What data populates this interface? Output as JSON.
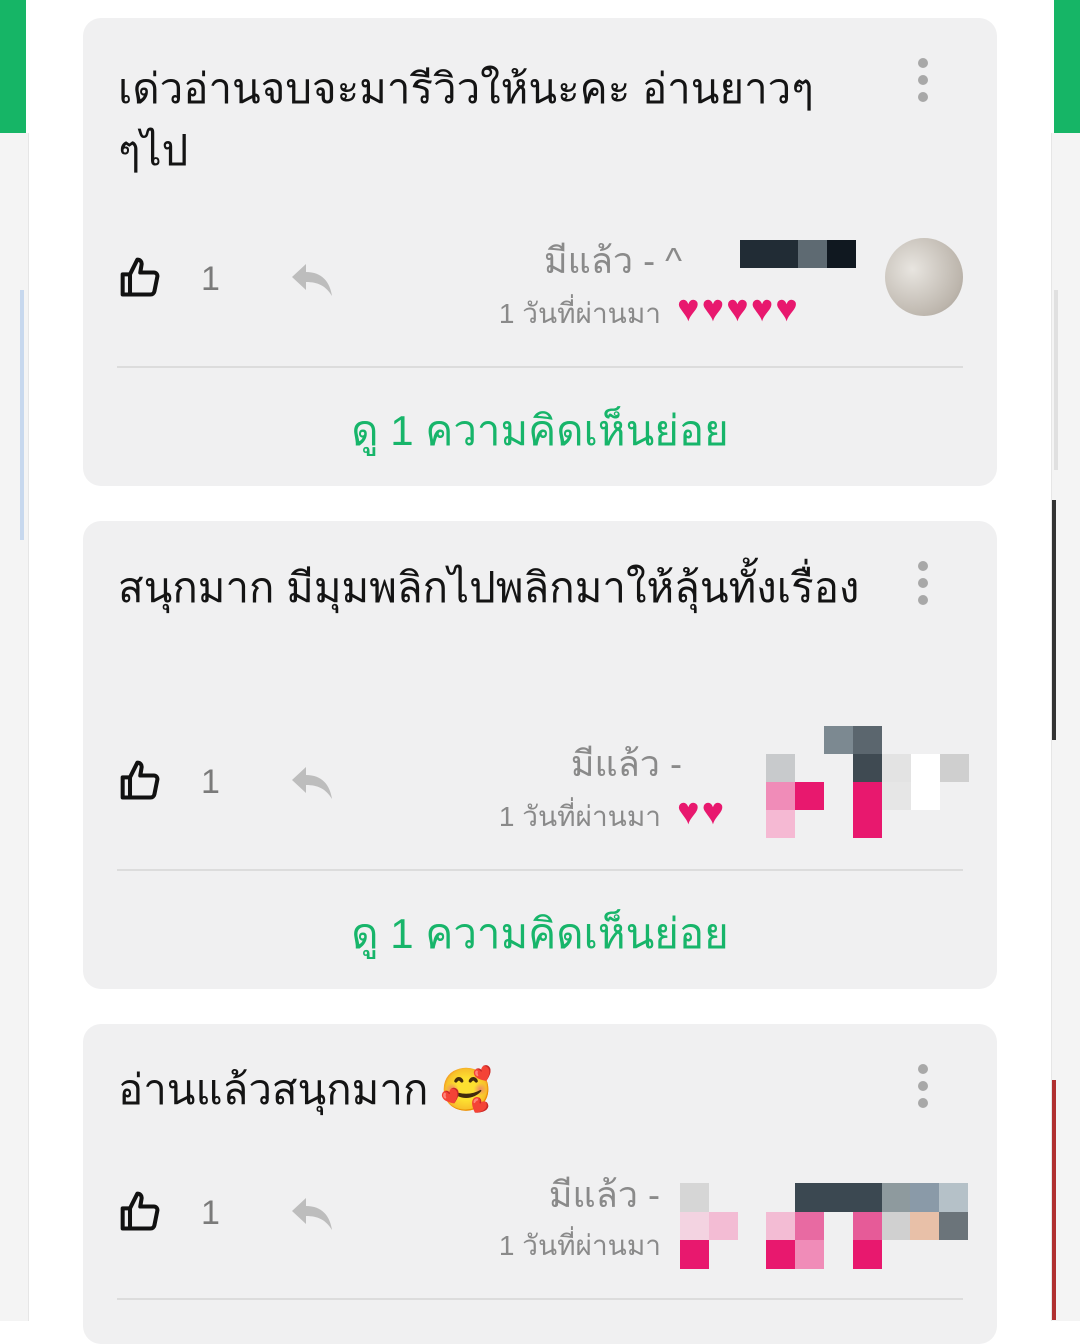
{
  "comments": [
    {
      "text": "เด่วอ่านจบจะมารีวิวให้นะคะ อ่านยาวๆ ๆไป",
      "likes": "1",
      "author": "มีแล้ว - ^",
      "time": "1 วันที่ผ่านมา",
      "hearts": "💗💗💗💗💗",
      "replies_link": "ดู 1 ความคิดเห็นย่อย"
    },
    {
      "text": "สนุกมาก  มีมุมพลิกไปพลิกมาให้ลุ้นทั้งเรื่อง",
      "likes": "1",
      "author": "มีแล้ว - ",
      "time": "1 วันที่ผ่านมา",
      "hearts": "💗💗",
      "replies_link": "ดู 1 ความคิดเห็นย่อย"
    },
    {
      "text": "อ่านแล้วสนุกมาก 🥰",
      "likes": "1",
      "author": "มีแล้ว - ",
      "time": "1 วันที่ผ่านมา",
      "hearts": ""
    }
  ],
  "icons": {
    "like": "thumbs-up-icon",
    "reply": "reply-arrow-icon",
    "more": "more-vertical-icon"
  },
  "colors": {
    "accent": "#17b56a",
    "heart": "#e8186e",
    "card_bg": "#f0f0f1"
  }
}
